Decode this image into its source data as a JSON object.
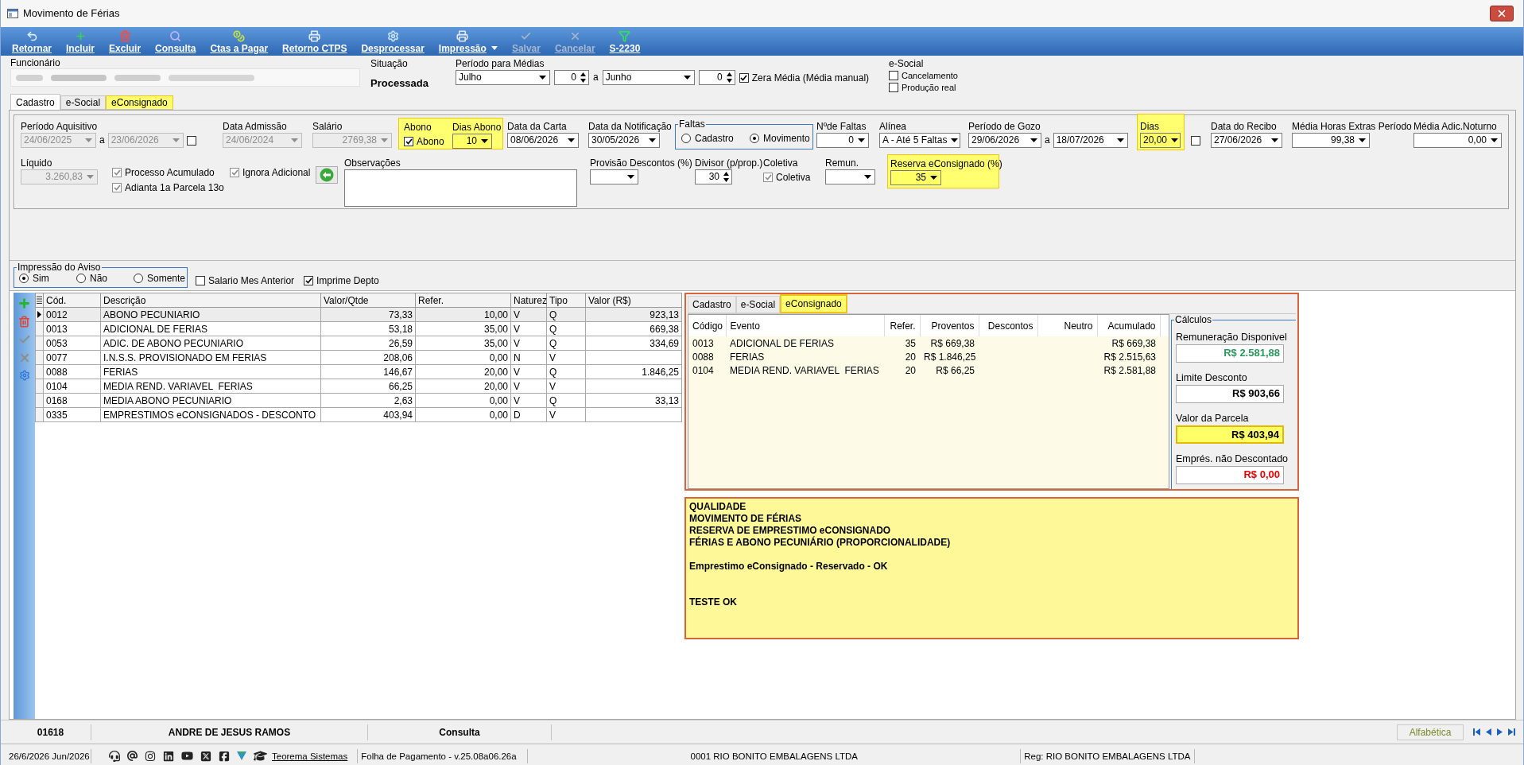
{
  "window": {
    "title": "Movimento de Férias"
  },
  "toolbar": [
    {
      "label": "Retornar",
      "disabled": false,
      "menu": false
    },
    {
      "label": "Incluir",
      "disabled": false,
      "menu": false
    },
    {
      "label": "Excluir",
      "disabled": false,
      "menu": false
    },
    {
      "label": "Consulta",
      "disabled": false,
      "menu": false
    },
    {
      "label": "Ctas a Pagar",
      "disabled": false,
      "menu": false
    },
    {
      "label": "Retorno CTPS",
      "disabled": false,
      "menu": false
    },
    {
      "label": "Desprocessar",
      "disabled": false,
      "menu": false
    },
    {
      "label": "Impressão",
      "disabled": false,
      "menu": true
    },
    {
      "label": "Salvar",
      "disabled": true,
      "menu": false
    },
    {
      "label": "Cancelar",
      "disabled": true,
      "menu": false
    },
    {
      "label": "S-2230",
      "disabled": false,
      "menu": false
    }
  ],
  "header": {
    "funcionario": {
      "label": "Funcionário"
    },
    "situacao": {
      "label": "Situação",
      "value": "Processada"
    },
    "periodo_medias": {
      "label": "Período para Médias",
      "from_month": "Julho",
      "from_year": "0",
      "separator": "a",
      "to_month": "Junho",
      "to_year": "0",
      "zera_media": {
        "label": "Zera Média (Média manual)",
        "checked": true
      }
    },
    "esocial": {
      "label": "e-Social",
      "options": [
        {
          "label": "Cancelamento",
          "checked": false
        },
        {
          "label": "Produção real",
          "checked": false
        }
      ]
    }
  },
  "tabs": [
    {
      "label": "Cadastro",
      "selected": true,
      "highlighted": false
    },
    {
      "label": "e-Social",
      "selected": false,
      "highlighted": false
    },
    {
      "label": "eConsignado",
      "selected": false,
      "highlighted": true
    }
  ],
  "cadastro": {
    "periodo_aquisitivo": {
      "label": "Período Aquisitivo",
      "from": "24/06/2025",
      "separator": "a",
      "to": "23/06/2026",
      "disabled": true,
      "checked": false
    },
    "data_admissao": {
      "label": "Data Admissão",
      "value": "24/06/2024",
      "disabled": true
    },
    "salario": {
      "label": "Salário",
      "value": "2769,38",
      "disabled": true
    },
    "abono": {
      "highlighted": true,
      "label": "Abono",
      "checkbox_label": "Abono",
      "checked": true,
      "days_label": "Dias Abono",
      "days": "10"
    },
    "data_carta": {
      "label": "Data da Carta",
      "value": "08/06/2026"
    },
    "data_notificacao": {
      "label": "Data da Notificação",
      "value": "30/05/2026"
    },
    "faltas": {
      "label": "Faltas",
      "options": [
        {
          "label": "Cadastro",
          "selected": false
        },
        {
          "label": "Movimento",
          "selected": true
        }
      ]
    },
    "n_faltas": {
      "label": "Nºde Faltas",
      "value": "0"
    },
    "alinea": {
      "label": "Alínea",
      "value": "A - Até 5 Faltas"
    },
    "periodo_gozo": {
      "label": "Período de Gozo",
      "from": "29/06/2026",
      "separator": "a",
      "to": "18/07/2026"
    },
    "dias": {
      "label": "Dias",
      "value": "20,00",
      "highlighted": true,
      "checked": false
    },
    "data_recibo": {
      "label": "Data do Recibo",
      "value": "27/06/2026"
    },
    "media_horas_extras": {
      "label": "Média Horas Extras Período",
      "value": "99,38"
    },
    "media_adic_noturno": {
      "label": "Média Adic.Noturno",
      "value": "0,00"
    },
    "liquido": {
      "label": "Líquido",
      "value": "3.260,83",
      "disabled": true
    },
    "processo_acumulado": {
      "label": "Processo Acumulado",
      "checked": true,
      "disabled": true
    },
    "adianta_13": {
      "label": "Adianta 1a Parcela 13o",
      "checked": true,
      "disabled": true
    },
    "ignora_adicional": {
      "label": "Ignora Adicional",
      "checked": true,
      "disabled": true
    },
    "observacoes": {
      "label": "Observações"
    },
    "provisao_descontos": {
      "label": "Provisão Descontos (%)"
    },
    "divisor": {
      "label": "Divisor (p/prop.)",
      "value": "30"
    },
    "coletiva": {
      "label": "Coletiva",
      "checkbox_label": "Coletiva",
      "checked": true,
      "disabled": true
    },
    "remun": {
      "label": "Remun."
    },
    "reserva_econsignado": {
      "label": "Reserva eConsignado (%)",
      "value": "35",
      "highlighted": true
    }
  },
  "impressao_aviso": {
    "label": "Impressão do Aviso",
    "options": [
      {
        "label": "Sim",
        "selected": true
      },
      {
        "label": "Não",
        "selected": false
      },
      {
        "label": "Somente",
        "selected": false
      }
    ]
  },
  "salario_mes_anterior": {
    "label": "Salario Mes Anterior",
    "checked": false
  },
  "imprime_depto": {
    "label": "Imprime Depto",
    "checked": true
  },
  "events": {
    "columns": [
      "Cód.",
      "Descrição",
      "Valor/Qtde",
      "Refer.",
      "Naturez",
      "Tipo",
      "Valor (R$)"
    ],
    "rows": [
      {
        "selected": true,
        "cod": "0012",
        "descricao": "ABONO PECUNIARIO",
        "valor_qtde": "73,33",
        "refer": "10,00",
        "natureza": "V",
        "tipo": "Q",
        "valor": "923,13"
      },
      {
        "selected": false,
        "cod": "0013",
        "descricao": "ADICIONAL DE FERIAS",
        "valor_qtde": "53,18",
        "refer": "35,00",
        "natureza": "V",
        "tipo": "Q",
        "valor": "669,38"
      },
      {
        "selected": false,
        "cod": "0053",
        "descricao": "ADIC. DE ABONO PECUNIARIO",
        "valor_qtde": "26,59",
        "refer": "35,00",
        "natureza": "V",
        "tipo": "Q",
        "valor": "334,69"
      },
      {
        "selected": false,
        "cod": "0077",
        "descricao": "I.N.S.S. PROVISIONADO EM FERIAS",
        "valor_qtde": "208,06",
        "refer": "0,00",
        "natureza": "N",
        "tipo": "V"
      },
      {
        "selected": false,
        "cod": "0088",
        "descricao": "FERIAS",
        "valor_qtde": "146,67",
        "refer": "20,00",
        "natureza": "V",
        "tipo": "Q",
        "valor": "1.846,25"
      },
      {
        "selected": false,
        "cod": "0104",
        "descricao": "MEDIA REND. VARIAVEL  FERIAS",
        "valor_qtde": "66,25",
        "refer": "20,00",
        "natureza": "V",
        "tipo": "V"
      },
      {
        "selected": false,
        "cod": "0168",
        "descricao": "MEDIA ABONO PECUNIARIO",
        "valor_qtde": "2,63",
        "refer": "0,00",
        "natureza": "V",
        "tipo": "Q",
        "valor": "33,13"
      },
      {
        "selected": false,
        "cod": "0335",
        "descricao": "EMPRESTIMOS eCONSIGNADOS - DESCONTO",
        "valor_qtde": "403,94",
        "refer": "0,00",
        "natureza": "D",
        "tipo": "V"
      }
    ]
  },
  "econsignado": {
    "tabs": [
      {
        "label": "Cadastro",
        "selected": false
      },
      {
        "label": "e-Social",
        "selected": false
      },
      {
        "label": "eConsignado",
        "selected": true
      }
    ],
    "columns": [
      "Código",
      "Evento",
      "Refer.",
      "Proventos",
      "Descontos",
      "Neutro",
      "Acumulado"
    ],
    "rows": [
      {
        "codigo": "0013",
        "evento": "ADICIONAL DE FERIAS",
        "refer": "35",
        "proventos": "R$ 669,38",
        "acumulado": "R$ 669,38"
      },
      {
        "codigo": "0088",
        "evento": "FERIAS",
        "refer": "20",
        "proventos": "R$ 1.846,25",
        "acumulado": "R$ 2.515,63"
      },
      {
        "codigo": "0104",
        "evento": "MEDIA REND. VARIAVEL  FERIAS",
        "refer": "20",
        "proventos": "R$ 66,25",
        "acumulado": "R$ 2.581,88"
      }
    ],
    "calculos": {
      "label": "Cálculos",
      "items": [
        {
          "label": "Remuneração Disponivel",
          "value": "R$ 2.581,88",
          "kind": "positive"
        },
        {
          "label": "Limite Desconto",
          "value": "R$ 903,66",
          "kind": "plain"
        },
        {
          "label": "Valor da Parcela",
          "value": "R$ 403,94",
          "kind": "highlight"
        },
        {
          "label": "Emprés. não Descontado",
          "value": "R$ 0,00",
          "kind": "negative"
        }
      ]
    },
    "notes": "QUALIDADE\nMOVIMENTO DE FÉRIAS\nRESERVA DE EMPRESTIMO eCONSIGNADO\nFÉRIAS E ABONO PECUNIÁRIO (PROPORCIONALIDADE)\n\nEmprestimo eConsignado - Reservado - OK\n\n\nTESTE OK"
  },
  "record_bar": {
    "code": "01618",
    "name": "ANDRE DE JESUS RAMOS",
    "mode": "Consulta",
    "sort": "Alfabética"
  },
  "status_bar": {
    "date": "26/6/2026 Jun/2026",
    "link": "Teorema Sistemas",
    "version": "Folha de Pagamento - v.25.08a06.26a",
    "company": "0001 RIO BONITO EMBALAGENS LTDA",
    "reg": "Reg: RIO BONITO EMBALAGENS LTDA"
  }
}
